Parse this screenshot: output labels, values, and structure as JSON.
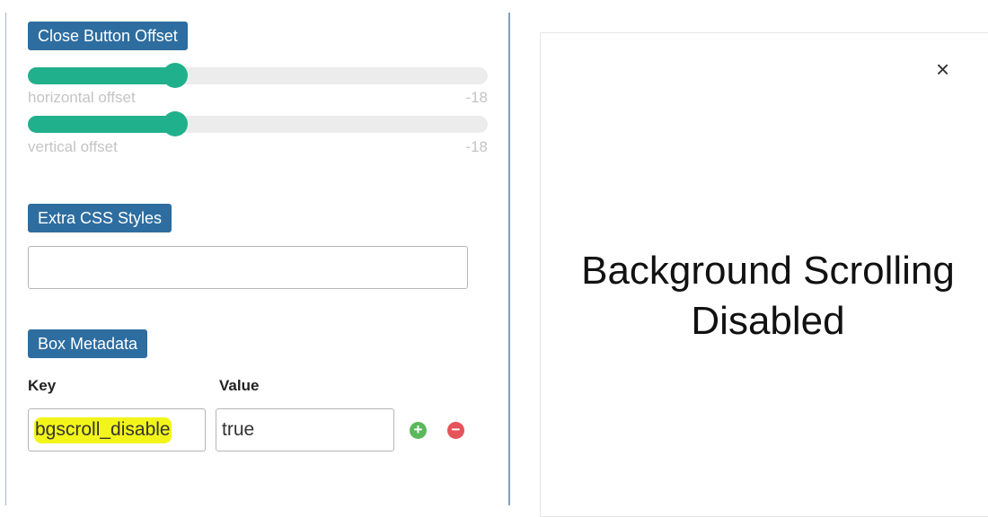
{
  "close_button_offset": {
    "label": "Close Button Offset",
    "horizontal": {
      "caption": "horizontal offset",
      "value": "-18",
      "level": 0.32
    },
    "vertical": {
      "caption": "vertical offset",
      "value": "-18",
      "level": 0.32
    }
  },
  "extra_css": {
    "label": "Extra CSS Styles",
    "value": ""
  },
  "box_metadata": {
    "label": "Box Metadata",
    "key_header": "Key",
    "value_header": "Value",
    "row": {
      "key": "bgscroll_disable",
      "value": "true"
    },
    "add_icon": "plus-circle-icon",
    "remove_icon": "minus-circle-icon"
  },
  "preview": {
    "close_icon": "×",
    "line1": "Background Scrolling",
    "line2": "Disabled"
  },
  "colors": {
    "label_bg": "#2e6d9f",
    "slider": "#21b08c",
    "highlight": "#f3f51a",
    "add": "#5cb85c",
    "remove": "#e5535b"
  }
}
